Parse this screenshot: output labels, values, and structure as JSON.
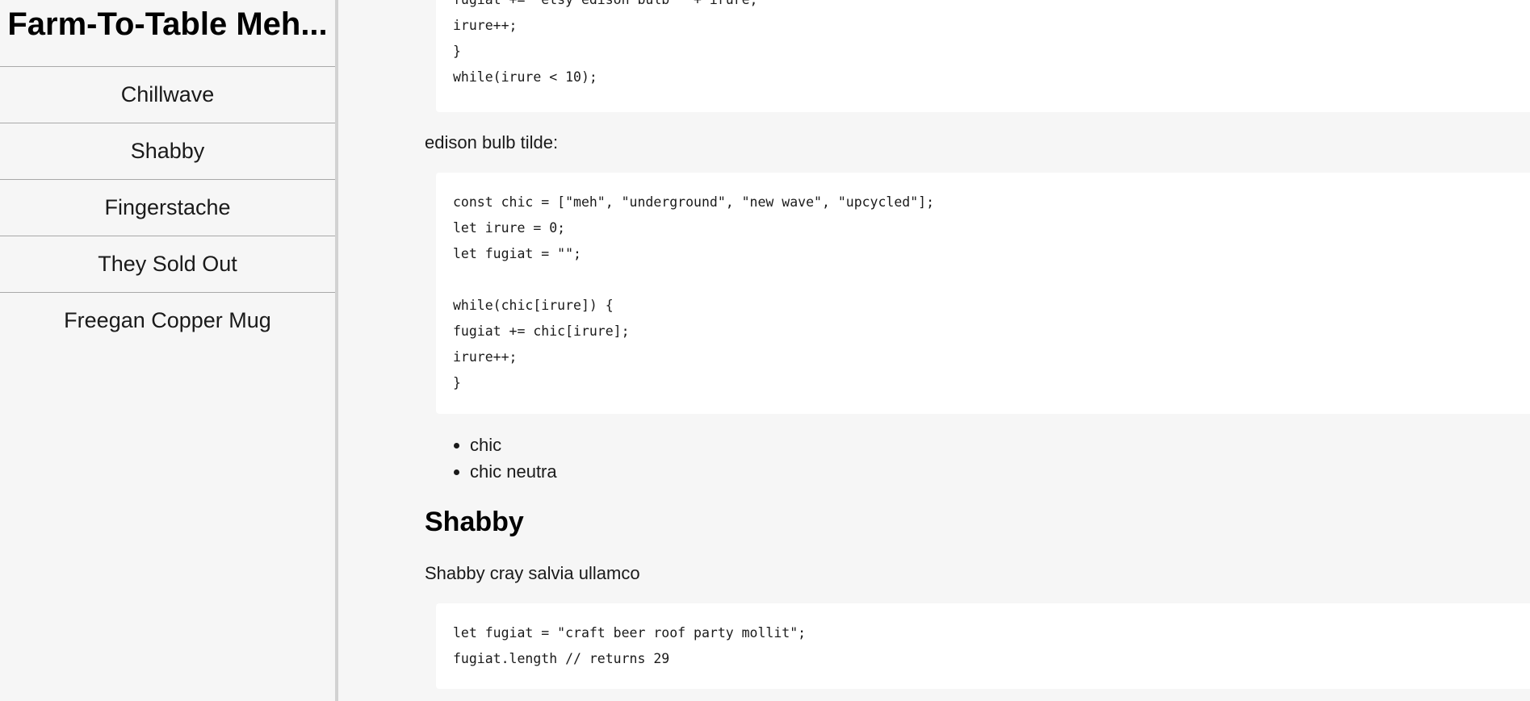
{
  "sidebar": {
    "title": "Farm-To-Table Meh...",
    "items": [
      {
        "label": "Chillwave"
      },
      {
        "label": "Shabby"
      },
      {
        "label": "Fingerstache"
      },
      {
        "label": "They Sold Out"
      },
      {
        "label": "Freegan Copper Mug"
      }
    ]
  },
  "main": {
    "code_block_1": {
      "lines": [
        "fugiat += \"etsy edison bulb \" + irure;",
        "irure++;",
        "}",
        "while(irure < 10);"
      ]
    },
    "paragraph_1": "edison bulb tilde:",
    "code_block_2": {
      "lines": [
        "const chic = [\"meh\", \"underground\", \"new wave\", \"upcycled\"];",
        "let irure = 0;",
        "let fugiat = \"\";",
        "",
        "while(chic[irure]) {",
        "fugiat += chic[irure];",
        "irure++;",
        "}"
      ]
    },
    "bullets": [
      "chic",
      "chic neutra"
    ],
    "section_heading": "Shabby",
    "paragraph_2": "Shabby cray salvia ullamco",
    "code_block_3": {
      "lines": [
        "let fugiat = \"craft beer roof party mollit\";",
        "fugiat.length // returns 29"
      ]
    }
  }
}
